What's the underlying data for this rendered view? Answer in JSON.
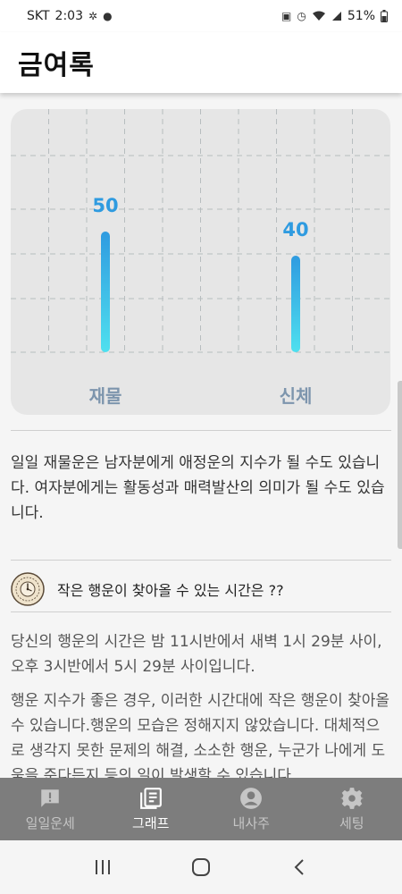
{
  "status_bar": {
    "carrier": "SKT",
    "time": "2:03",
    "battery": "51%"
  },
  "app_bar": {
    "title": "금여록"
  },
  "chart_data": {
    "type": "bar",
    "categories": [
      "재물",
      "신체"
    ],
    "values": [
      50,
      40
    ],
    "ylim": [
      0,
      100
    ],
    "grid": true,
    "colors": {
      "bar_top": "#2f9be0",
      "bar_bottom": "#4fe0ef",
      "value_label": "#2f9be0",
      "category_label": "#7d95ad"
    }
  },
  "description": "일일 재물운은 남자분에게 애정운의 지수가 될 수도 있습니다. 여자분에게는 활동성과 매력발산의 의미가 될 수도 있습니다.",
  "fortune": {
    "title": "작은 행운이 찾아올 수 있는 시간은 ??",
    "paragraph1": "당신의 행운의 시간은 밤 11시반에서 새벽 1시 29분 사이, 오후 3시반에서 5시 29분 사이입니다.",
    "paragraph2": "행운 지수가 좋은 경우, 이러한 시간대에 작은 행운이 찾아올 수 있습니다.행운의 모습은 정해지지 않았습니다. 대체적으로 생각지 못한 문제의 해결, 소소한 행운, 누군가 나에게 도움을 준다든지 등의 일이 발생할 수 있습니다."
  },
  "bottom_nav": {
    "items": [
      {
        "label": "일일운세",
        "icon": "alert-message-icon",
        "active": false
      },
      {
        "label": "그래프",
        "icon": "list-document-icon",
        "active": true
      },
      {
        "label": "내사주",
        "icon": "account-circle-icon",
        "active": false
      },
      {
        "label": "세팅",
        "icon": "settings-gear-icon",
        "active": false
      }
    ]
  },
  "colors": {
    "nav_bg": "#7d7d7d",
    "nav_active": "#ffffff",
    "nav_inactive": "#c6c6c6"
  }
}
